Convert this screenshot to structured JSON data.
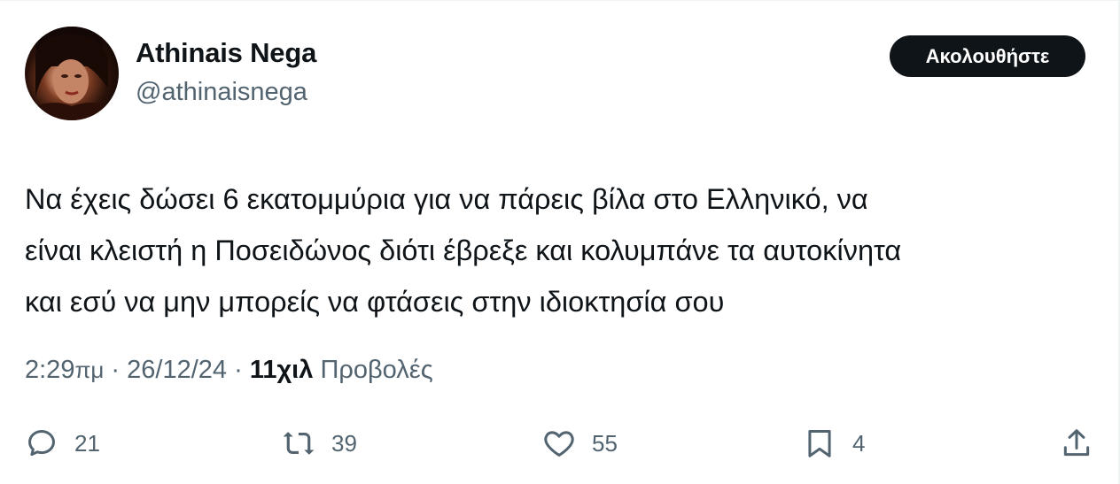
{
  "author": {
    "name": "Athinais Nega",
    "handle": "@athinaisnega"
  },
  "follow_button": {
    "label": "Ακολουθήστε"
  },
  "tweet": {
    "lines": [
      "Να έχεις δώσει 6 εκατομμύρια για να πάρεις βίλα στο Ελληνικό, να",
      "είναι κλειστή η Ποσειδώνος διότι έβρεξε και κολυμπάνε τα αυτοκίνητα",
      "και εσύ να μην μπορείς να φτάσεις στην ιδιοκτησία σου"
    ]
  },
  "meta": {
    "time": "2:29",
    "ampm": "πμ",
    "separator": " · ",
    "date": "26/12/24",
    "views_count": "11χιλ",
    "views_label": "Προβολές"
  },
  "actions": {
    "replies": "21",
    "reposts": "39",
    "likes": "55",
    "bookmarks": "4"
  },
  "icons": {
    "reply": "reply-icon",
    "repost": "repost-icon",
    "like": "heart-icon",
    "bookmark": "bookmark-icon",
    "share": "share-icon"
  },
  "colors": {
    "text": "#0f1419",
    "secondary": "#536471",
    "button_bg": "#0f1419",
    "button_text": "#ffffff"
  }
}
